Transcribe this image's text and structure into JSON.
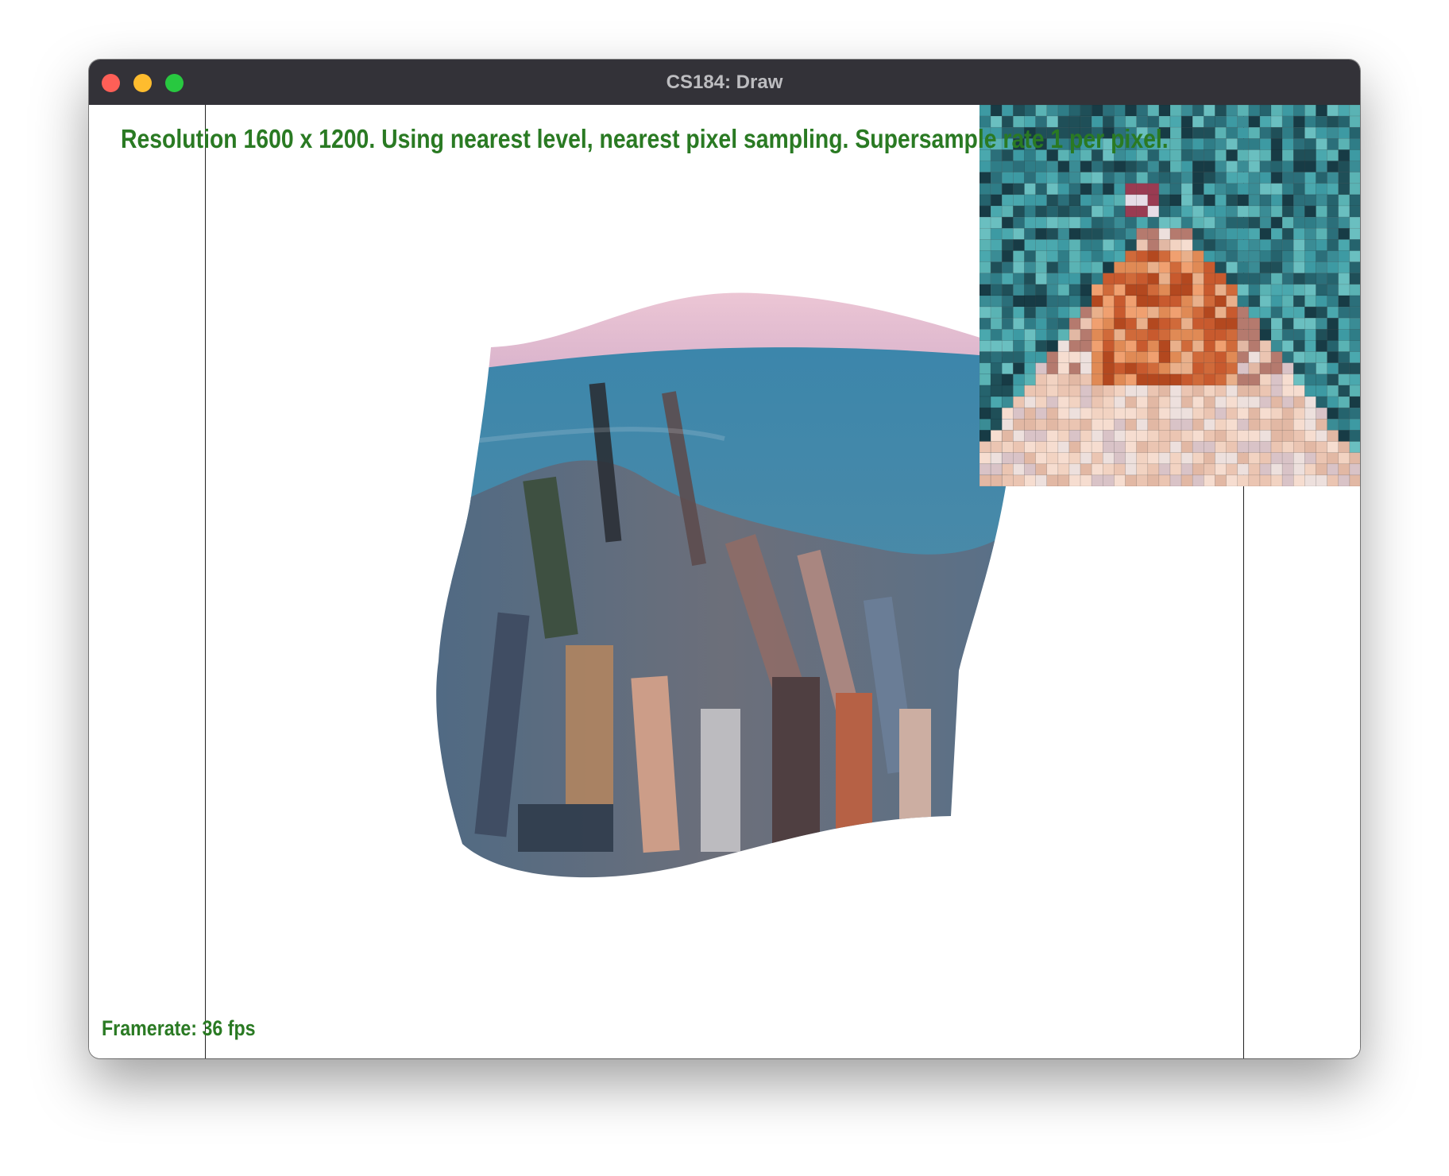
{
  "window": {
    "title": "CS184: Draw"
  },
  "hud": {
    "status_text": "Resolution 1600 x 1200. Using nearest level, nearest pixel sampling. Supersample rate 1 per pixel.",
    "framerate_text": "Framerate: 36 fps"
  },
  "colors": {
    "titlebar": "#333238",
    "hud_text": "#2a7a23",
    "close": "#fe5f57",
    "minimize": "#febc2e",
    "maximize": "#28c840"
  },
  "icons": [
    "close-button",
    "minimize-button",
    "maximize-button"
  ]
}
